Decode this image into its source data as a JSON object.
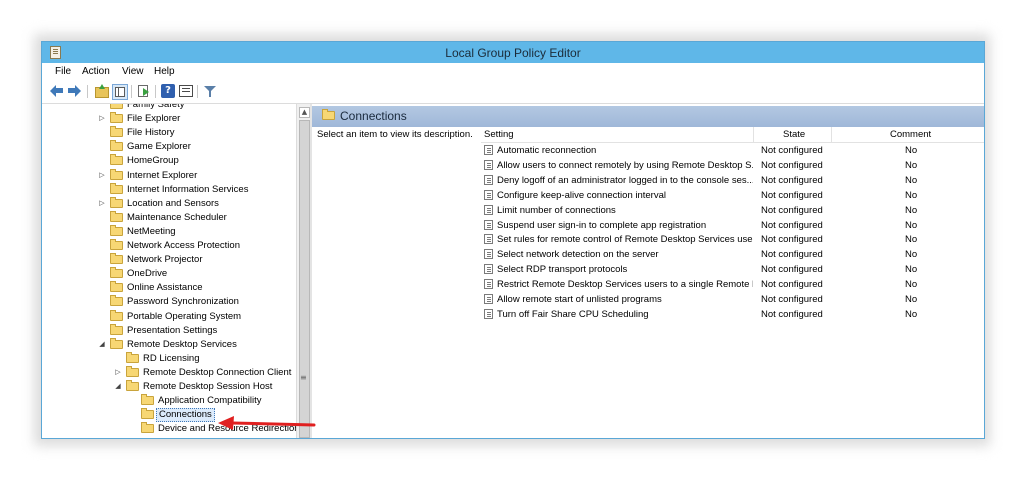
{
  "window": {
    "title": "Local Group Policy Editor"
  },
  "menu": [
    "File",
    "Action",
    "View",
    "Help"
  ],
  "toolbar": {
    "buttons": [
      "back-arrow-icon",
      "forward-arrow-icon",
      "up-folder-icon",
      "show-hide-tree-icon",
      "export-list-icon",
      "help-icon",
      "properties-icon",
      "filter-icon"
    ],
    "help_glyph": "?"
  },
  "tree": {
    "items": [
      {
        "label": "Family Safety",
        "expander": ""
      },
      {
        "label": "File Explorer",
        "expander": "▷"
      },
      {
        "label": "File History",
        "expander": ""
      },
      {
        "label": "Game Explorer",
        "expander": ""
      },
      {
        "label": "HomeGroup",
        "expander": ""
      },
      {
        "label": "Internet Explorer",
        "expander": "▷"
      },
      {
        "label": "Internet Information Services",
        "expander": ""
      },
      {
        "label": "Location and Sensors",
        "expander": "▷"
      },
      {
        "label": "Maintenance Scheduler",
        "expander": ""
      },
      {
        "label": "NetMeeting",
        "expander": ""
      },
      {
        "label": "Network Access Protection",
        "expander": ""
      },
      {
        "label": "Network Projector",
        "expander": ""
      },
      {
        "label": "OneDrive",
        "expander": ""
      },
      {
        "label": "Online Assistance",
        "expander": ""
      },
      {
        "label": "Password Synchronization",
        "expander": ""
      },
      {
        "label": "Portable Operating System",
        "expander": ""
      },
      {
        "label": "Presentation Settings",
        "expander": ""
      },
      {
        "label": "Remote Desktop Services",
        "expander": "◢"
      },
      {
        "label": "RD Licensing",
        "expander": ""
      },
      {
        "label": "Remote Desktop Connection Client",
        "expander": "▷"
      },
      {
        "label": "Remote Desktop Session Host",
        "expander": "◢"
      },
      {
        "label": "Application Compatibility",
        "expander": ""
      },
      {
        "label": "Connections",
        "expander": "",
        "selected": true
      },
      {
        "label": "Device and Resource Redirection",
        "expander": ""
      }
    ]
  },
  "scrollbar": {
    "up_glyph": "▲",
    "grip_glyph": "≡"
  },
  "right": {
    "header": "Connections",
    "description": "Select an item to view its description.",
    "columns": [
      "Setting",
      "State",
      "Comment"
    ],
    "rows": [
      {
        "setting": "Automatic reconnection",
        "state": "Not configured",
        "comment": "No"
      },
      {
        "setting": "Allow users to connect remotely by using Remote Desktop S...",
        "state": "Not configured",
        "comment": "No"
      },
      {
        "setting": "Deny logoff of an administrator logged in to the console ses...",
        "state": "Not configured",
        "comment": "No"
      },
      {
        "setting": "Configure keep-alive connection interval",
        "state": "Not configured",
        "comment": "No"
      },
      {
        "setting": "Limit number of connections",
        "state": "Not configured",
        "comment": "No"
      },
      {
        "setting": "Suspend user sign-in to complete app registration",
        "state": "Not configured",
        "comment": "No"
      },
      {
        "setting": "Set rules for remote control of Remote Desktop Services use...",
        "state": "Not configured",
        "comment": "No"
      },
      {
        "setting": "Select network detection on the server",
        "state": "Not configured",
        "comment": "No"
      },
      {
        "setting": "Select RDP transport protocols",
        "state": "Not configured",
        "comment": "No"
      },
      {
        "setting": "Restrict Remote Desktop Services users to a single Remote D...",
        "state": "Not configured",
        "comment": "No"
      },
      {
        "setting": "Allow remote start of unlisted programs",
        "state": "Not configured",
        "comment": "No"
      },
      {
        "setting": "Turn off Fair Share CPU Scheduling",
        "state": "Not configured",
        "comment": "No"
      }
    ]
  },
  "colors": {
    "titlebar": "#5fb7e8",
    "header": "#b3c8e2",
    "annotation_arrow": "#e02020"
  }
}
